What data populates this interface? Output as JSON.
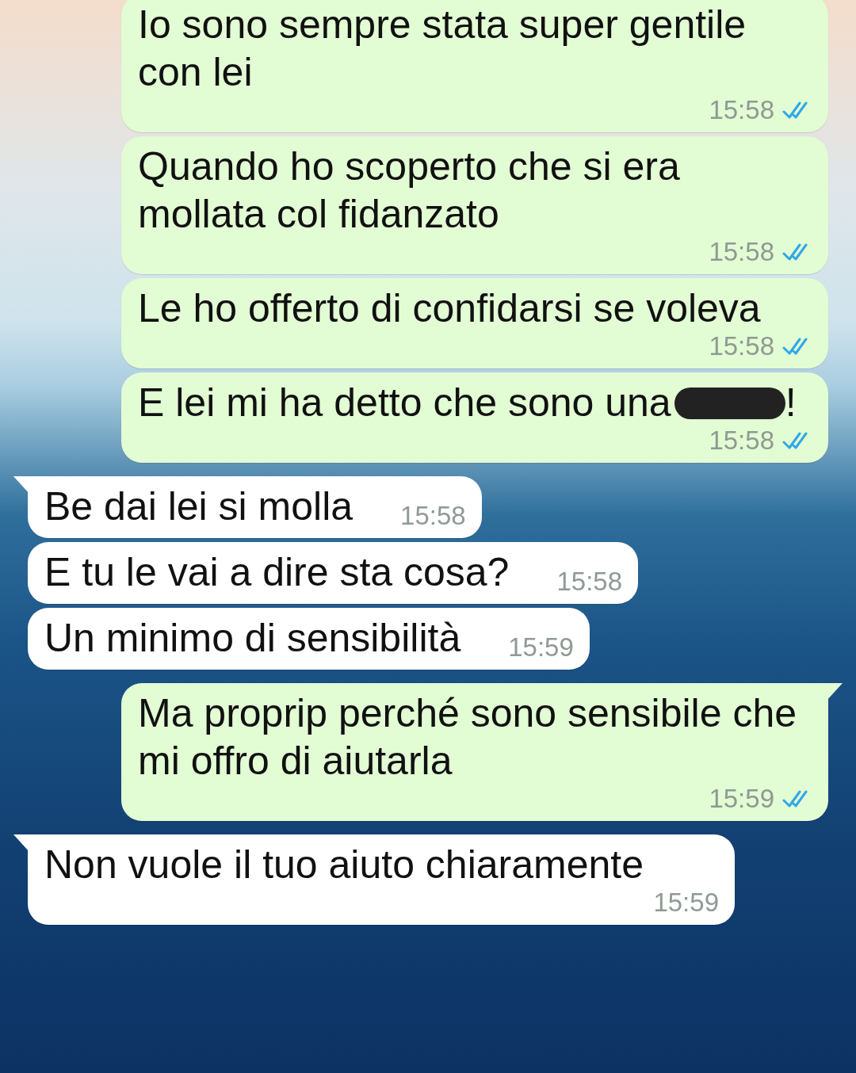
{
  "messages": [
    {
      "kind": "outgoing",
      "tail": false,
      "text": "Io sono sempre stata super gentile con lei",
      "time": "15:58",
      "read": true
    },
    {
      "kind": "outgoing",
      "tail": false,
      "text": "Quando ho scoperto che si era mollata col fidanzato",
      "time": "15:58",
      "read": true
    },
    {
      "kind": "outgoing",
      "tail": false,
      "text": "Le ho offerto di confidarsi se voleva",
      "time": "15:58",
      "read": true
    },
    {
      "kind": "outgoing",
      "tail": false,
      "text": "E lei mi ha detto che sono una",
      "redacted": true,
      "text_after": "!",
      "time": "15:58",
      "read": true
    },
    {
      "kind": "incoming",
      "tail": true,
      "text": "Be dai lei si molla",
      "time": "15:58"
    },
    {
      "kind": "incoming",
      "tail": false,
      "text": "E tu le vai a dire sta cosa?",
      "time": "15:58"
    },
    {
      "kind": "incoming",
      "tail": false,
      "text": "Un minimo di sensibilità",
      "time": "15:59"
    },
    {
      "kind": "outgoing",
      "tail": true,
      "text": "Ma proprip perché sono sensibile che mi offro di aiutarla",
      "time": "15:59",
      "read": true
    },
    {
      "kind": "incoming",
      "tail": true,
      "text": "Non vuole il tuo aiuto chiaramente",
      "time": "15:59"
    }
  ]
}
